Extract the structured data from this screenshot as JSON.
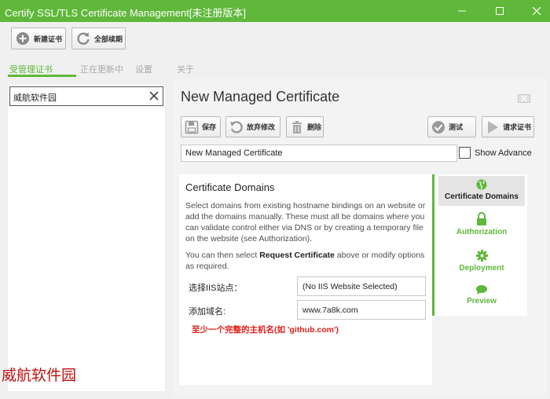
{
  "window": {
    "title": "Certify SSL/TLS Certificate Management[未注册版本]",
    "accent_color": "#5fb83a"
  },
  "toolbar": {
    "new_cert_label": "新建证书",
    "renew_all_label": "全部续期"
  },
  "tabs": [
    {
      "label": "受管理证书",
      "active": true
    },
    {
      "label": "正在更新中",
      "active": false
    },
    {
      "label": "设置",
      "active": false
    },
    {
      "label": "关于",
      "active": false
    }
  ],
  "search": {
    "value": "威航软件园"
  },
  "main": {
    "heading": "New Managed Certificate",
    "actions": {
      "save_label": "保存",
      "discard_label": "放弃修改",
      "delete_label": "删除",
      "test_label": "测试",
      "request_label": "请求证书"
    },
    "name_value": "New Managed Certificate",
    "show_advanced_label": "Show Advance",
    "show_advanced_checked": false
  },
  "domains_panel": {
    "title": "Certificate Domains",
    "description": "Select domains from existing hostname bindings on an website or add the domains manually. These must all be domains where you can validate control either via DNS or by creating a temporary file on the website (see Authorization).",
    "hint_prefix": "You can then select ",
    "hint_bold": "Request Certificate",
    "hint_suffix": " above or modify options as required.",
    "site_label": "选择IIS站点：",
    "site_value": "(No IIS Website Selected)",
    "domain_label": "添加域名:",
    "domain_value": "www.7a8k.com",
    "error_text": "至少一个完整的主机名(如 'github.com')"
  },
  "side_nav": [
    {
      "label": "Certificate Domains",
      "icon": "globe-icon",
      "selected": true
    },
    {
      "label": "Authorization",
      "icon": "lock-icon",
      "selected": false
    },
    {
      "label": "Deployment",
      "icon": "gear-icon",
      "selected": false
    },
    {
      "label": "Preview",
      "icon": "speech-bubble-icon",
      "selected": false
    }
  ],
  "watermark": "威航软件园"
}
